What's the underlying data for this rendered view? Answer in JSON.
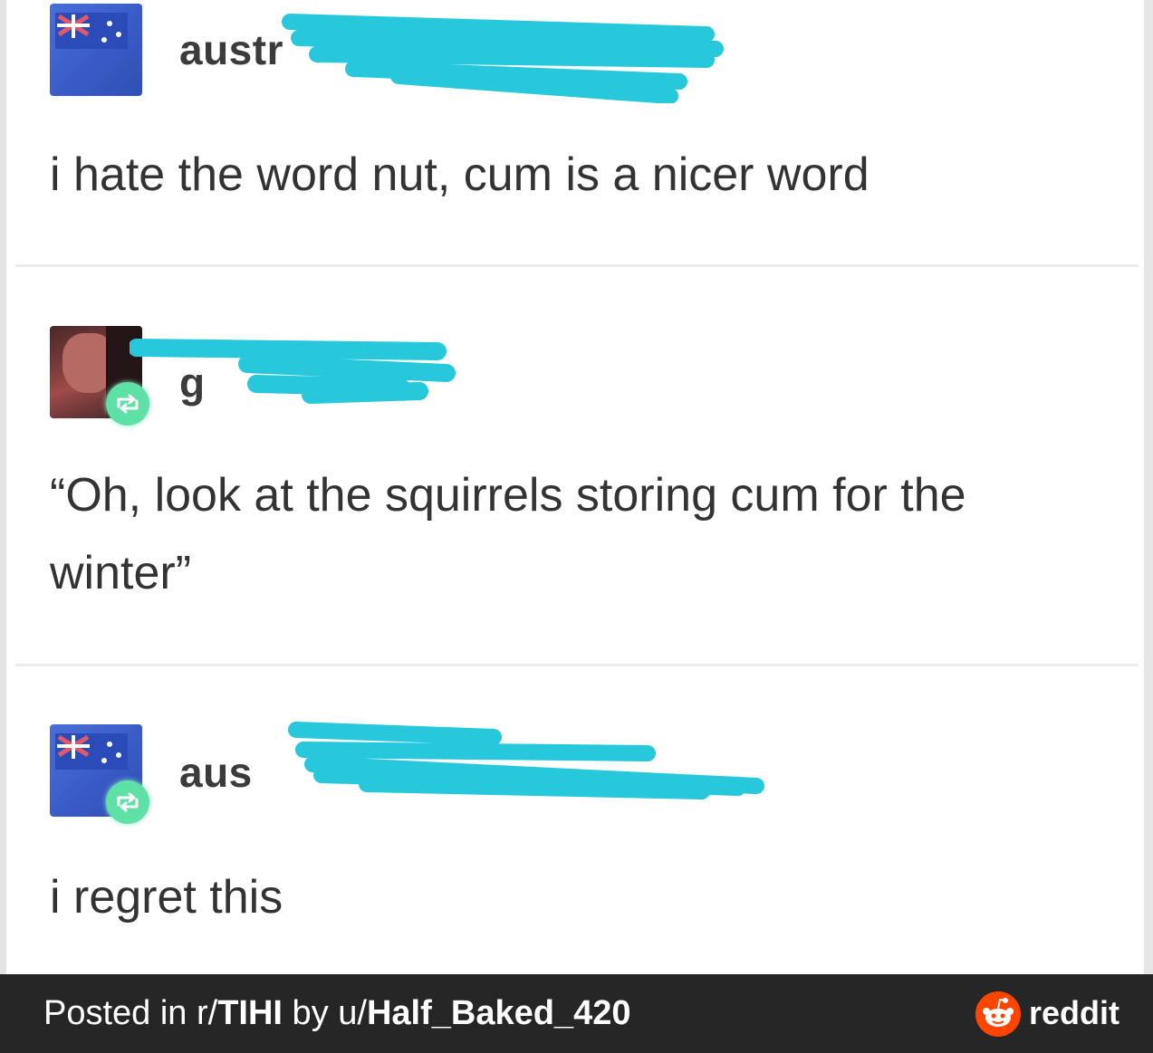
{
  "posts": [
    {
      "username": "austr",
      "text": "i hate the word nut, cum is a nicer word",
      "avatar": "australian-flag-avatar",
      "reblog": false
    },
    {
      "username": "g",
      "text": "“Oh, look at the squirrels storing cum for the winter”",
      "avatar": "person-photo-avatar",
      "reblog": true
    },
    {
      "username": "aus",
      "text": "i regret this",
      "avatar": "australian-flag-avatar",
      "reblog": true
    }
  ],
  "footer": {
    "prefix": "Posted in r/",
    "subreddit": "TIHI",
    "by": " by u/",
    "user": "Half_Baked_420",
    "brand": "reddit"
  },
  "colors": {
    "redaction": "#27c8dc",
    "reblog_badge": "#5fe0a6",
    "footer_bg": "#262626",
    "reddit_orange": "#ff4500"
  },
  "icons": [
    "reblog-icon",
    "reddit-logo-icon"
  ]
}
